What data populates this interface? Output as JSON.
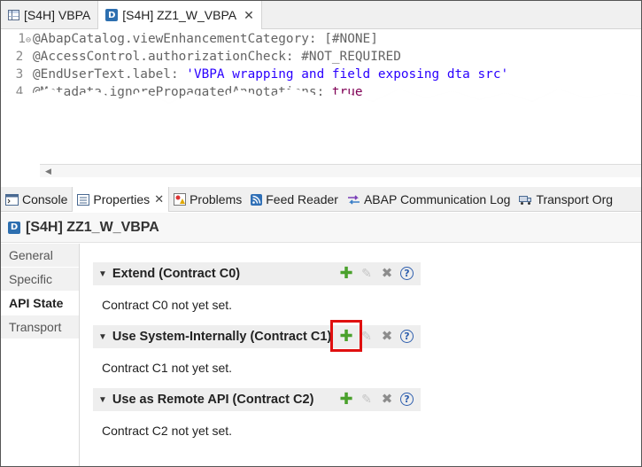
{
  "editor_tabs": [
    {
      "label": "[S4H] VBPA",
      "icon": "table-icon"
    },
    {
      "label": "[S4H] ZZ1_W_VBPA",
      "icon": "ddl-source-icon",
      "close": "✕"
    }
  ],
  "code": {
    "lines": [
      {
        "num": "1",
        "text": "@AbapCatalog.viewEnhancementCategory: [#NONE]"
      },
      {
        "num": "2",
        "text": "@AccessControl.authorizationCheck: #NOT_REQUIRED"
      },
      {
        "num": "3",
        "pre": "@EndUserText.label: ",
        "str": "'VBPA wrapping and field exposing dta src'"
      },
      {
        "num": "4",
        "pre": "@Metadata.ignorePropagatedAnnotations: ",
        "kw": "true"
      }
    ]
  },
  "view_tabs": [
    {
      "label": "Console",
      "icon": "console-icon"
    },
    {
      "label": "Properties",
      "icon": "properties-icon",
      "close": "✕"
    },
    {
      "label": "Problems",
      "icon": "problems-icon"
    },
    {
      "label": "Feed Reader",
      "icon": "feed-icon"
    },
    {
      "label": "ABAP Communication Log",
      "icon": "communication-log-icon"
    },
    {
      "label": "Transport Org",
      "icon": "transport-icon"
    }
  ],
  "header": {
    "title": "[S4H] ZZ1_W_VBPA"
  },
  "sidebar": {
    "items": [
      {
        "label": "General"
      },
      {
        "label": "Specific"
      },
      {
        "label": "API State",
        "active": true
      },
      {
        "label": "Transport"
      }
    ]
  },
  "sections": [
    {
      "title": "Extend (Contract C0)",
      "message": "Contract C0 not yet set."
    },
    {
      "title": "Use System-Internally (Contract C1)",
      "message": "Contract C1 not yet set.",
      "highlight_add": true
    },
    {
      "title": "Use as Remote API (Contract C2)",
      "message": "Contract C2 not yet set."
    }
  ],
  "colors": {
    "highlight": "#e01010",
    "add_icon": "#4aa12c",
    "help_icon": "#2f5fae"
  }
}
